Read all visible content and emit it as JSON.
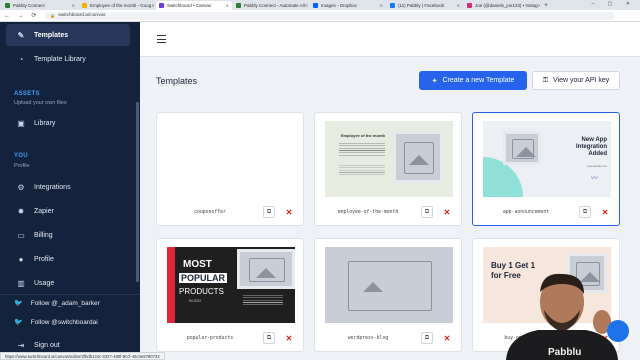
{
  "browser": {
    "tabs": [
      {
        "label": "Pabbly Connect",
        "color": "#2e7d32"
      },
      {
        "label": "Employee of the month - Goog",
        "color": "#f4b400"
      },
      {
        "label": "Switchboard • Canvas",
        "color": "#6a3fd6"
      },
      {
        "label": "Pabbly Connect - Automate All",
        "color": "#2e7d32"
      },
      {
        "label": "Images - Dropbox",
        "color": "#0061fe"
      },
      {
        "label": "(11) Pabbly | Facebook",
        "color": "#1877f2"
      },
      {
        "label": "Joe (@daniels_joe123) • Instag",
        "color": "#d62976"
      }
    ],
    "new_tab": "+",
    "window_controls": "– ▢ ✕",
    "nav": "← → ⟳",
    "url": "switchboard.ai/canvas",
    "status_url": "https://www.switchboard.ai/canvas/editor/2fbdb134c-8327-480f-9ccf-46c0e8780733"
  },
  "sidebar": {
    "items_top": [
      {
        "label": "Templates",
        "icon": "edit-icon",
        "glyph": "✎"
      },
      {
        "label": "Template Library",
        "icon": "library-icon",
        "glyph": "◔"
      }
    ],
    "assets_heading": "ASSETS",
    "assets_sub": "Upload your own files",
    "library": {
      "label": "Library",
      "glyph": "▣"
    },
    "you_heading": "YOU",
    "you_sub": "Profile",
    "items_you": [
      {
        "label": "Integrations",
        "glyph": "⚙"
      },
      {
        "label": "Zapier",
        "glyph": "✹"
      },
      {
        "label": "Billing",
        "glyph": "▭"
      },
      {
        "label": "Profile",
        "glyph": "●"
      },
      {
        "label": "Usage",
        "glyph": "▥"
      }
    ],
    "follow": [
      {
        "label": "Follow @_adam_barker"
      },
      {
        "label": "Follow @switchboardai"
      }
    ],
    "sign_out": {
      "label": "Sign out",
      "glyph": "⇥"
    }
  },
  "main": {
    "title": "Templates",
    "create_button": "Create a new Template",
    "api_button": "View your API key",
    "cards": [
      {
        "name": "couponoffer"
      },
      {
        "name": "employee-of-the-month",
        "thumb_title": "Employee of the month"
      },
      {
        "name": "app-announcement",
        "thumb_title": "New App Integration Added",
        "thumb_url": "www.website.com"
      },
      {
        "name": "popular-products",
        "thumb_line1": "MOST",
        "thumb_line2": "POPULAR",
        "thumb_line3": "PRODUCTS",
        "thumb_line4": "IN 2022"
      },
      {
        "name": "wordpress-blog"
      },
      {
        "name": "buy-one-get-one",
        "thumb_line1": "Buy 1 Get 1",
        "thumb_line2": "for Free"
      }
    ]
  },
  "overlay": {
    "brand": "Pabblu"
  },
  "colors": {
    "primary": "#2563eb",
    "sidebar": "#14233c",
    "danger": "#d81e1e"
  }
}
